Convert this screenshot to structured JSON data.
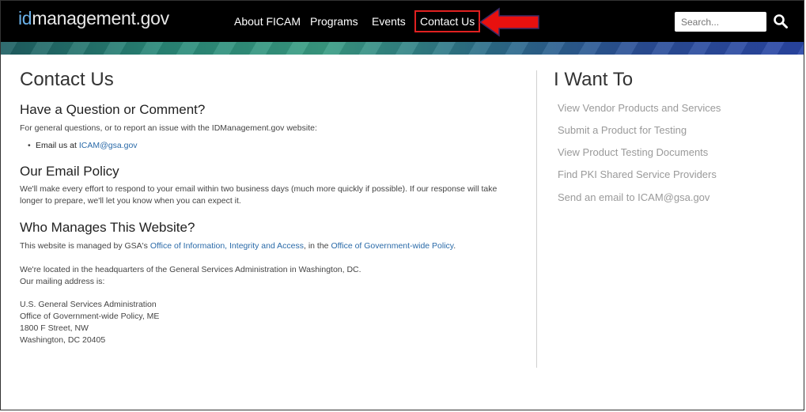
{
  "header": {
    "logo_prefix": "id",
    "logo_suffix": "management.gov",
    "nav": [
      {
        "label": "About FICAM"
      },
      {
        "label": "Programs"
      },
      {
        "label": "Events"
      },
      {
        "label": "Contact Us"
      }
    ],
    "search": {
      "placeholder": "Search..."
    }
  },
  "main": {
    "title": "Contact Us",
    "question": {
      "heading": "Have a Question or Comment?",
      "text": "For general questions, or to report an issue with the IDManagement.gov website:",
      "bullet_prefix": "Email us at ",
      "email": "ICAM@gsa.gov"
    },
    "policy": {
      "heading": "Our Email Policy",
      "line1": "We'll make every effort to respond to your email within two business days (much more quickly if possible). If our response will take",
      "line2": "longer to prepare, we'll let you know when you can expect it."
    },
    "manages": {
      "heading": "Who Manages This Website?",
      "text_prefix": "This website is managed by GSA's ",
      "link1": "Office of Information, Integrity and Access",
      "text_mid": ", in the ",
      "link2": "Office of Government-wide Policy",
      "text_end": ".",
      "location_line1": "We're located in the headquarters of the General Services Administration in Washington, DC.",
      "location_line2": "Our mailing address is:",
      "address": [
        "U.S. General Services Administration",
        "Office of Government-wide Policy, ME",
        "1800 F Street, NW",
        "Washington, DC 20405"
      ]
    }
  },
  "sidebar": {
    "title": "I Want To",
    "links": [
      {
        "label": "View Vendor Products and Services"
      },
      {
        "label": "Submit a Product for Testing"
      },
      {
        "label": "View Product Testing Documents"
      },
      {
        "label": "Find PKI Shared Service Providers"
      },
      {
        "label": "Send an email to ICAM@gsa.gov"
      }
    ]
  },
  "colors": {
    "topbar": "#000000",
    "link": "#2a6aa8",
    "highlight": "#e02020"
  }
}
